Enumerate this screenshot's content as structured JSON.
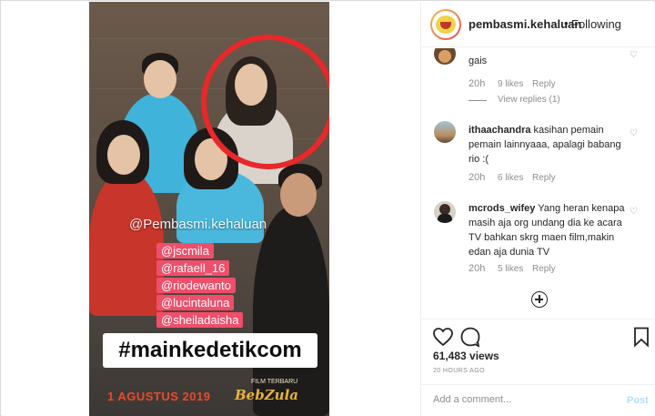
{
  "story": {
    "watermark": "@Pembasmi.kehaluan",
    "mentions": [
      "@jscmila",
      "@rafaell_16",
      "@riodewanto",
      "@lucintaluna",
      "@sheiladaisha"
    ],
    "hashtag": "#mainkedetikcom",
    "date": "1 AGUSTUS 2019",
    "promo_small": "FILM TERBARU",
    "promo_logo": "BebZula"
  },
  "header": {
    "username": "pembasmi.kehaluan",
    "separator": "•",
    "follow_status": "Following"
  },
  "comments": [
    {
      "username": "",
      "text": "gais",
      "time": "20h",
      "likes": "9 likes",
      "reply": "Reply",
      "view_replies": "View replies (1)"
    },
    {
      "username": "ithaachandra",
      "text": "kasihan pemain pemain lainnyaaa, apalagi babang rio :(",
      "time": "20h",
      "likes": "6 likes",
      "reply": "Reply"
    },
    {
      "username": "mcrods_wifey",
      "text": "Yang heran kenapa masih aja org undang dia ke acara TV bahkan skrg maen film,makin edan aja dunia TV",
      "time": "20h",
      "likes": "5 likes",
      "reply": "Reply"
    }
  ],
  "actions": {
    "likes_count": "61,483 views",
    "time_ago": "20 HOURS AGO"
  },
  "add_comment": {
    "placeholder": "Add a comment...",
    "post_label": "Post"
  },
  "colors": {
    "highlight_circle": "#e8282a",
    "mention_bg": "#ef4f6b",
    "link_disabled": "#b2dffc"
  }
}
